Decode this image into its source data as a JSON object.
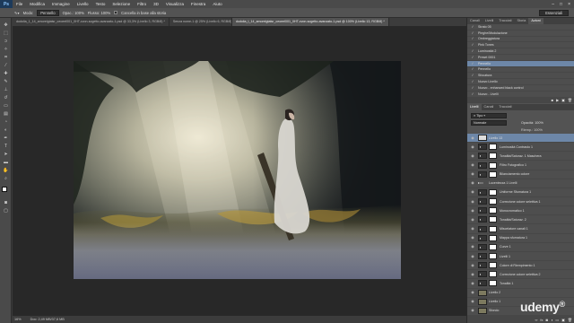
{
  "app": {
    "logo": "Ps",
    "window_controls": [
      "–",
      "□",
      "×"
    ]
  },
  "menu": [
    "File",
    "Modifica",
    "Immagine",
    "Livello",
    "Testo",
    "Selezione",
    "Filtro",
    "3D",
    "Visualizza",
    "Finestra",
    "Aiuto"
  ],
  "options": {
    "mode_label": "Modo:",
    "mode_value": "Pennello",
    "opacity_label": "Opac.: 100%",
    "flow_label": "Flusso: 100%",
    "erase_history": "Cancella in base alla storia",
    "workspace": "Essenziali"
  },
  "tabs": [
    {
      "label": "dodolia_1_14_amorelgtatsr_ceoeel001_0HT-cvon-sogetto-avanzato-1.psd @ 33,3% (Livello 3, RGB/8) *",
      "active": false
    },
    {
      "label": "Senza nome-1 @ 25% (Livello 6, RGB/8) *",
      "active": false
    },
    {
      "label": "dodolia_t_14_amorelgtatsr_ceoeel001_0HT-cvon-sogetto-avanzato-1.psd @ 100% (Livello 13, RGB/8) *",
      "active": true
    }
  ],
  "status": {
    "zoom": "16%",
    "doc": "Doc: 2,49 MB/37,6 MB"
  },
  "history": {
    "tabs": [
      "Canali",
      "Livelli",
      "Tracciati",
      "Storia",
      "Azioni"
    ],
    "items": [
      "Strato 05",
      "Pieghe/Modulazione",
      "Ombreggiatura",
      "Pink Tones",
      "Luminosità 2",
      "Preset 0001",
      "Pennello",
      "Pennello",
      "Sfocatura",
      "Nuovo Livello",
      "Nuovo - enhanced black control",
      "Nuovo - Livelli"
    ],
    "selected": 6
  },
  "layers": {
    "tabs": [
      "Livelli",
      "Canali",
      "Tracciati"
    ],
    "blend": "Normale",
    "opacity": "Opacità: 100%",
    "fill": "Riemp.: 100%",
    "items": [
      {
        "name": "Livello 13",
        "type": "pixel",
        "selected": true
      },
      {
        "name": "Luminosità Contrasto 1",
        "type": "adj"
      },
      {
        "name": "Tonalità/Saturaz. 1 Maschera",
        "type": "adj"
      },
      {
        "name": "Filtro Fotografico 1",
        "type": "adj"
      },
      {
        "name": "Bilanciamento colore",
        "type": "adj"
      },
      {
        "name": "Lucentezza 1 Livelli",
        "type": "group"
      },
      {
        "name": "Uniforme Sfumatura 1",
        "type": "adj"
      },
      {
        "name": "Correzione colore selettiva 1",
        "type": "adj"
      },
      {
        "name": "Monocromatico 1",
        "type": "adj"
      },
      {
        "name": "Tonalità/Saturaz. 2",
        "type": "adj"
      },
      {
        "name": "Miscelatore canali 1",
        "type": "adj"
      },
      {
        "name": "Mappa sfumatura 1",
        "type": "adj"
      },
      {
        "name": "Curve 1",
        "type": "adj"
      },
      {
        "name": "Livelli 1",
        "type": "adj"
      },
      {
        "name": "Colore di Riempimento 1",
        "type": "adj"
      },
      {
        "name": "Correzione colore selettiva 2",
        "type": "adj"
      },
      {
        "name": "Tonalità 1",
        "type": "adj"
      },
      {
        "name": "Livello 2",
        "type": "pixel"
      },
      {
        "name": "Livello 1",
        "type": "pixel"
      },
      {
        "name": "Sfondo",
        "type": "pixel"
      }
    ]
  },
  "watermark": {
    "brand": "udemy",
    "mark": "®"
  }
}
